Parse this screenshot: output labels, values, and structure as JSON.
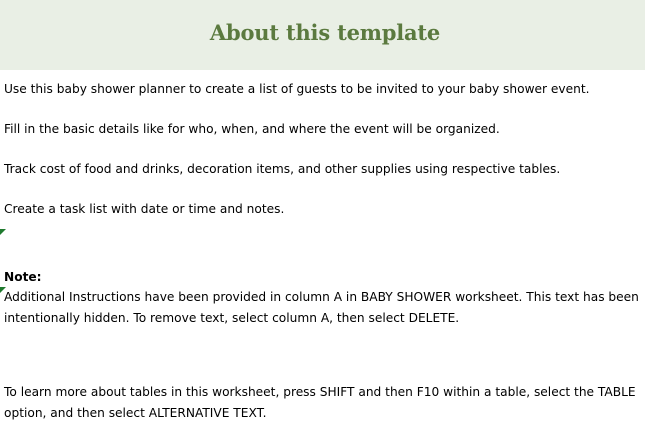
{
  "title": "About this template",
  "lines": {
    "l1": "Use this baby shower planner to create a list of guests to be invited to your baby shower event.",
    "l2": "Fill in the basic details like for who, when, and where the event will be organized.",
    "l3": "Track cost of food and drinks, decoration items, and other supplies using respective tables.",
    "l4": "Create a task list with date or time and notes."
  },
  "note": {
    "label": "Note:",
    "line1": "Additional Instructions have been provided in column A in BABY SHOWER worksheet. This text has been",
    "line2": "intentionally hidden. To remove text, select column A, then select DELETE."
  },
  "tables_info": {
    "line1": "To learn more about tables in this worksheet, press SHIFT and then F10 within a table, select the TABLE",
    "line2": "option, and then select ALTERNATIVE TEXT."
  },
  "colors": {
    "title": "#5b7a3f",
    "header_band": "#e9efe5",
    "comment_marker": "#1f7a2e"
  }
}
